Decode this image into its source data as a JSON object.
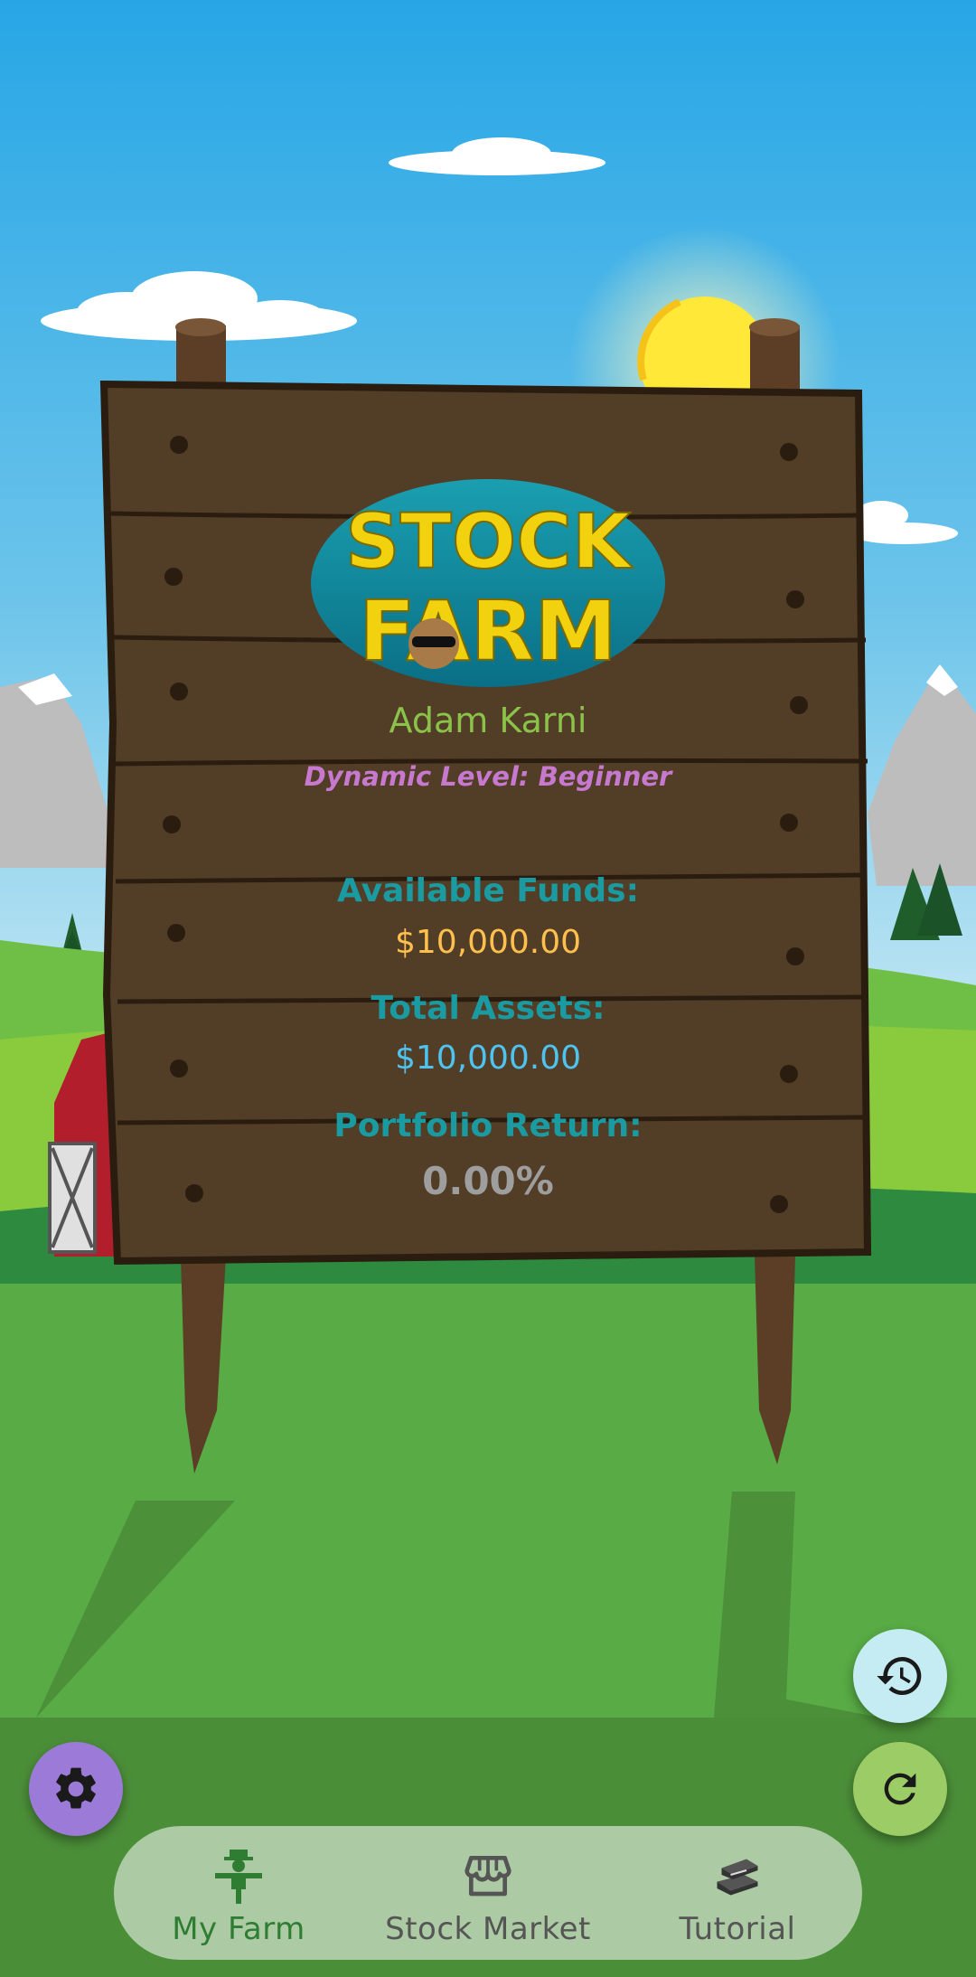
{
  "app": {
    "logo_line1": "STOCK",
    "logo_line2": "FARM"
  },
  "player": {
    "name": "Adam Karni",
    "level": "Dynamic Level: Beginner"
  },
  "stats": {
    "funds_label": "Available Funds:",
    "funds_value": "$10,000.00",
    "assets_label": "Total Assets:",
    "assets_value": "$10,000.00",
    "return_label": "Portfolio Return:",
    "return_value": "0.00%"
  },
  "fabs": {
    "settings_icon": "gear-icon",
    "history_icon": "history-icon",
    "refresh_icon": "refresh-icon"
  },
  "nav": {
    "items": [
      {
        "label": "My Farm",
        "icon": "scarecrow-icon",
        "active": true
      },
      {
        "label": "Stock Market",
        "icon": "storefront-icon",
        "active": false
      },
      {
        "label": "Tutorial",
        "icon": "books-icon",
        "active": false
      }
    ]
  },
  "colors": {
    "sky_top": "#2eaae6",
    "grass": "#5aae3f",
    "sign_wood": "#523d27",
    "name_green": "#8bc34a",
    "level_purple": "#c779d0",
    "label_teal": "#1a9ba1",
    "funds_gold": "#ffc04d",
    "assets_blue": "#4ec3f0",
    "return_gray": "#9e9e9e",
    "settings_purple": "#9c7bd8",
    "history_cyan": "#c5ecf2",
    "refresh_green": "#9ccc65"
  }
}
